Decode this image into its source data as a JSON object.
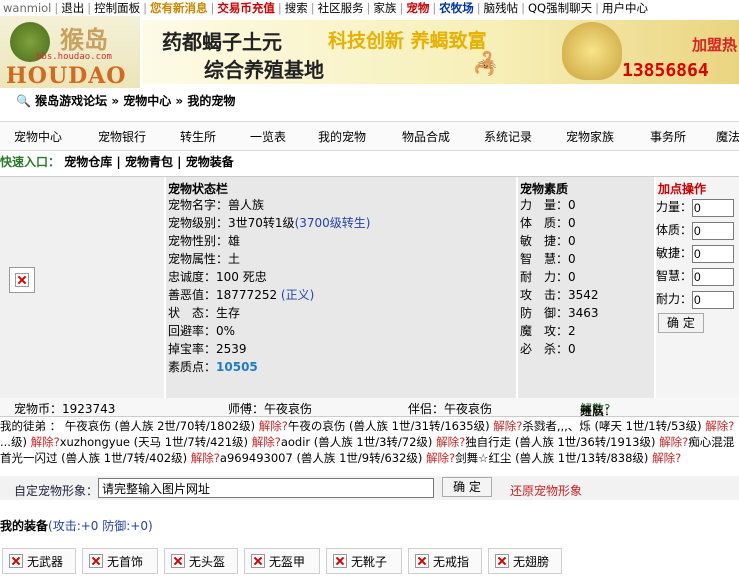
{
  "topbar": {
    "links": [
      "wanmiol",
      "退出",
      "控制面板",
      "您有新消息",
      "交易币充值",
      "搜索",
      "社区服务",
      "家族",
      "宠物",
      "农牧场",
      "脑残帖",
      "QQ强制聊天",
      "用户中心"
    ]
  },
  "banner": {
    "logo_cn": "猴岛",
    "logo_url": "bbs.houdao.com",
    "logo_en": "HOUDAO",
    "ad_line1": "药都蝎子土元",
    "ad_line2": "综合养殖基地",
    "ad_slogan": "科技创新 养蝎致富",
    "ad_join": "加盟热",
    "ad_phone": "13856864"
  },
  "breadcrumb": "猴岛游戏论坛 » 宠物中心 » 我的宠物",
  "mainnav": [
    "宠物中心",
    "宠物银行",
    "转生所",
    "一览表",
    "我的宠物",
    "物品合成",
    "系统记录",
    "宠物家族",
    "事务所",
    "魔法"
  ],
  "quick": {
    "label": "快速入口：",
    "links": [
      "宠物仓库",
      "宠物青包",
      "宠物装备"
    ]
  },
  "status": {
    "title": "宠物状态栏",
    "name_label": "宠物名字：",
    "name": "兽人族",
    "level_label": "宠物级别：",
    "level": "3世70转1级",
    "level_link": "(3700级转生)",
    "gender_label": "宠物性别：",
    "gender": "雄",
    "element_label": "宠物属性：",
    "element": "土",
    "loyalty_label": "忠诚度：",
    "loyalty": "100 死忠",
    "karma_label": "善恶值：",
    "karma": "18777252",
    "karma_link": "(正义)",
    "state_label": "状　态：",
    "state": "生存",
    "dodge_label": "回避率：",
    "dodge": "0%",
    "drop_label": "掉宝率：",
    "drop": "2539",
    "points_label": "素质点：",
    "points": "10505"
  },
  "attributes": {
    "title": "宠物素质",
    "rows": [
      {
        "label": "力　量：",
        "value": "0"
      },
      {
        "label": "体　质：",
        "value": "0"
      },
      {
        "label": "敏　捷：",
        "value": "0"
      },
      {
        "label": "智　慧：",
        "value": "0"
      },
      {
        "label": "耐　力：",
        "value": "0"
      },
      {
        "label": "攻　击：",
        "value": "3542"
      },
      {
        "label": "防　御：",
        "value": "3463"
      },
      {
        "label": "魔　攻：",
        "value": "2"
      },
      {
        "label": "必　杀：",
        "value": "0"
      }
    ]
  },
  "add_points": {
    "title": "加点操作",
    "rows": [
      {
        "label": "力量：",
        "value": "0"
      },
      {
        "label": "体质：",
        "value": "0"
      },
      {
        "label": "敏捷：",
        "value": "0"
      },
      {
        "label": "智慧：",
        "value": "0"
      },
      {
        "label": "耐力：",
        "value": "0"
      }
    ],
    "confirm": "确 定"
  },
  "infobar": {
    "coins": "宠物币：1923743",
    "master": "师傅：午夜哀伤",
    "partner": "伴侣：午夜哀伤",
    "team": "组队：",
    "team_state": "开启",
    "team_arrow": "→",
    "team_link": "解散?"
  },
  "disciples": {
    "line1": [
      {
        "t": "我的徒弟 ： 午夜哀伤 (兽人族 2世/70转/1802级) ",
        "c": ""
      },
      {
        "t": "解除?",
        "c": "red"
      },
      {
        "t": "午夜の哀伤 (兽人族 1世/31转/1635级) ",
        "c": ""
      },
      {
        "t": "解除?",
        "c": "red"
      },
      {
        "t": "杀戮者,,,、烁 (哮天 1世/1转/53级) ",
        "c": ""
      },
      {
        "t": "解除?",
        "c": "red"
      }
    ],
    "line2": [
      {
        "t": "...级) ",
        "c": ""
      },
      {
        "t": "解除?",
        "c": "red"
      },
      {
        "t": "xuzhongyue (天马 1世/7转/421级) ",
        "c": ""
      },
      {
        "t": "解除?",
        "c": "red"
      },
      {
        "t": "aodir (兽人族 1世/3转/72级) ",
        "c": ""
      },
      {
        "t": "解除?",
        "c": "red"
      },
      {
        "t": "独自行走 (兽人族 1世/36转/1913级) ",
        "c": ""
      },
      {
        "t": "解除?",
        "c": "red"
      },
      {
        "t": "痴心混混",
        "c": ""
      }
    ],
    "line3": [
      {
        "t": "首光一闪过 (兽人族 1世/7转/402级) ",
        "c": ""
      },
      {
        "t": "解除?",
        "c": "red"
      },
      {
        "t": "a969493007 (兽人族 1世/9转/632级) ",
        "c": ""
      },
      {
        "t": "解除?",
        "c": "red"
      },
      {
        "t": "剑舞☆红尘 (兽人族 1世/13转/838级) ",
        "c": ""
      },
      {
        "t": "解除?",
        "c": "red"
      }
    ]
  },
  "custom": {
    "label": "自定宠物形象：",
    "input_value": "请完整输入图片网址",
    "confirm": "确 定",
    "restore": "还原宠物形象"
  },
  "equipment": {
    "title": "我的装备",
    "stats": "(攻击:+0 防御:+0)",
    "slots": [
      "无武器",
      "无首饰",
      "无头盔",
      "无盔甲",
      "无靴子",
      "无戒指",
      "无翅膀"
    ]
  }
}
